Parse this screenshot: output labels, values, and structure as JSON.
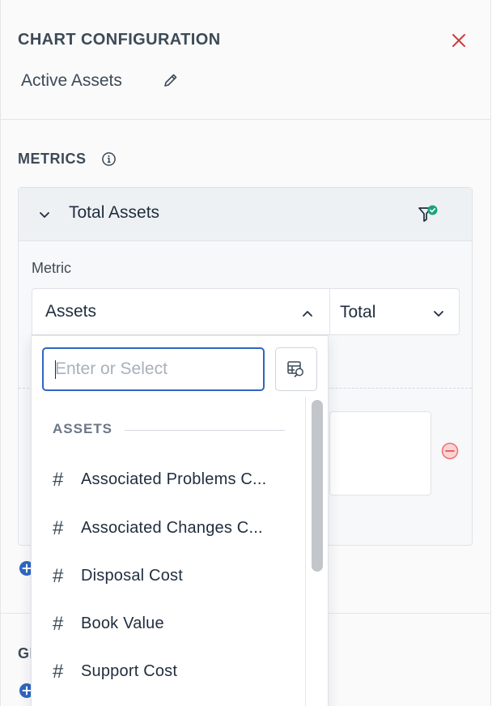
{
  "panel": {
    "title": "CHART CONFIGURATION",
    "chart_name": "Active Assets",
    "close_icon": "close-icon",
    "edit_icon": "pencil-icon"
  },
  "metrics": {
    "section_label": "METRICS",
    "card_title": "Total Assets",
    "metric_label": "Metric",
    "metric_value": "Assets",
    "aggregation_value": "Total"
  },
  "group": {
    "section_label_partial": "GI"
  },
  "dropdown": {
    "search_placeholder": "Enter or Select",
    "group_heading": "ASSETS",
    "items": [
      {
        "icon": "#",
        "label": "Associated Problems C..."
      },
      {
        "icon": "#",
        "label": "Associated Changes C..."
      },
      {
        "icon": "#",
        "label": "Disposal Cost"
      },
      {
        "icon": "#",
        "label": "Book Value"
      },
      {
        "icon": "#",
        "label": "Support Cost"
      }
    ]
  },
  "colors": {
    "accent_blue": "#2f66c3",
    "close_red": "#d13b3b",
    "remove_red": "#f07070",
    "filter_check_green": "#1aa37a"
  }
}
